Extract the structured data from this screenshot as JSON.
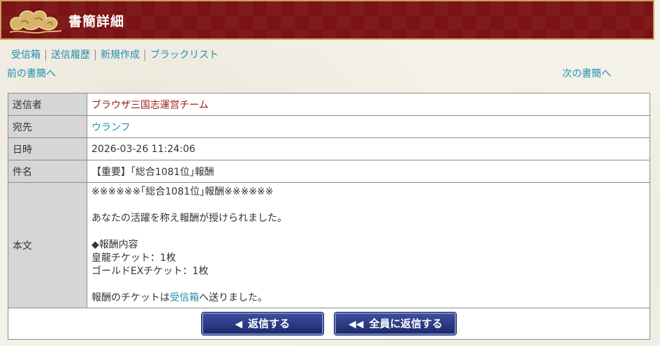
{
  "header": {
    "title": "書簡詳細"
  },
  "nav": {
    "items": [
      "受信箱",
      "送信履歴",
      "新規作成",
      "ブラックリスト"
    ],
    "prev": "前の書簡へ",
    "next": "次の書簡へ"
  },
  "mail": {
    "sender_label": "送信者",
    "sender": "ブラウザ三国志運営チーム",
    "to_label": "宛先",
    "to": "ウランフ",
    "date_label": "日時",
    "date": "2026-03-26 11:24:06",
    "subject_label": "件名",
    "subject": "【重要】｢総合1081位｣報酬",
    "body_label": "本文",
    "body": {
      "line1": "※※※※※※｢総合1081位｣報酬※※※※※※",
      "line2": "あなたの活躍を称え報酬が授けられました。",
      "line3": "◆報酬内容",
      "line4": "皇龍チケット：1枚",
      "line5": "ゴールドEXチケット：1枚",
      "line6_pre": "報酬のチケットは",
      "line6_link": "受信箱",
      "line6_post": "へ送りました。"
    }
  },
  "buttons": {
    "reply": "返信する",
    "reply_all": "全員に返信する"
  },
  "colors": {
    "header_bg": "#7b1214",
    "link": "#1f8fb0",
    "sender": "#9a1d1d",
    "button_bg": "#2a3a82"
  }
}
